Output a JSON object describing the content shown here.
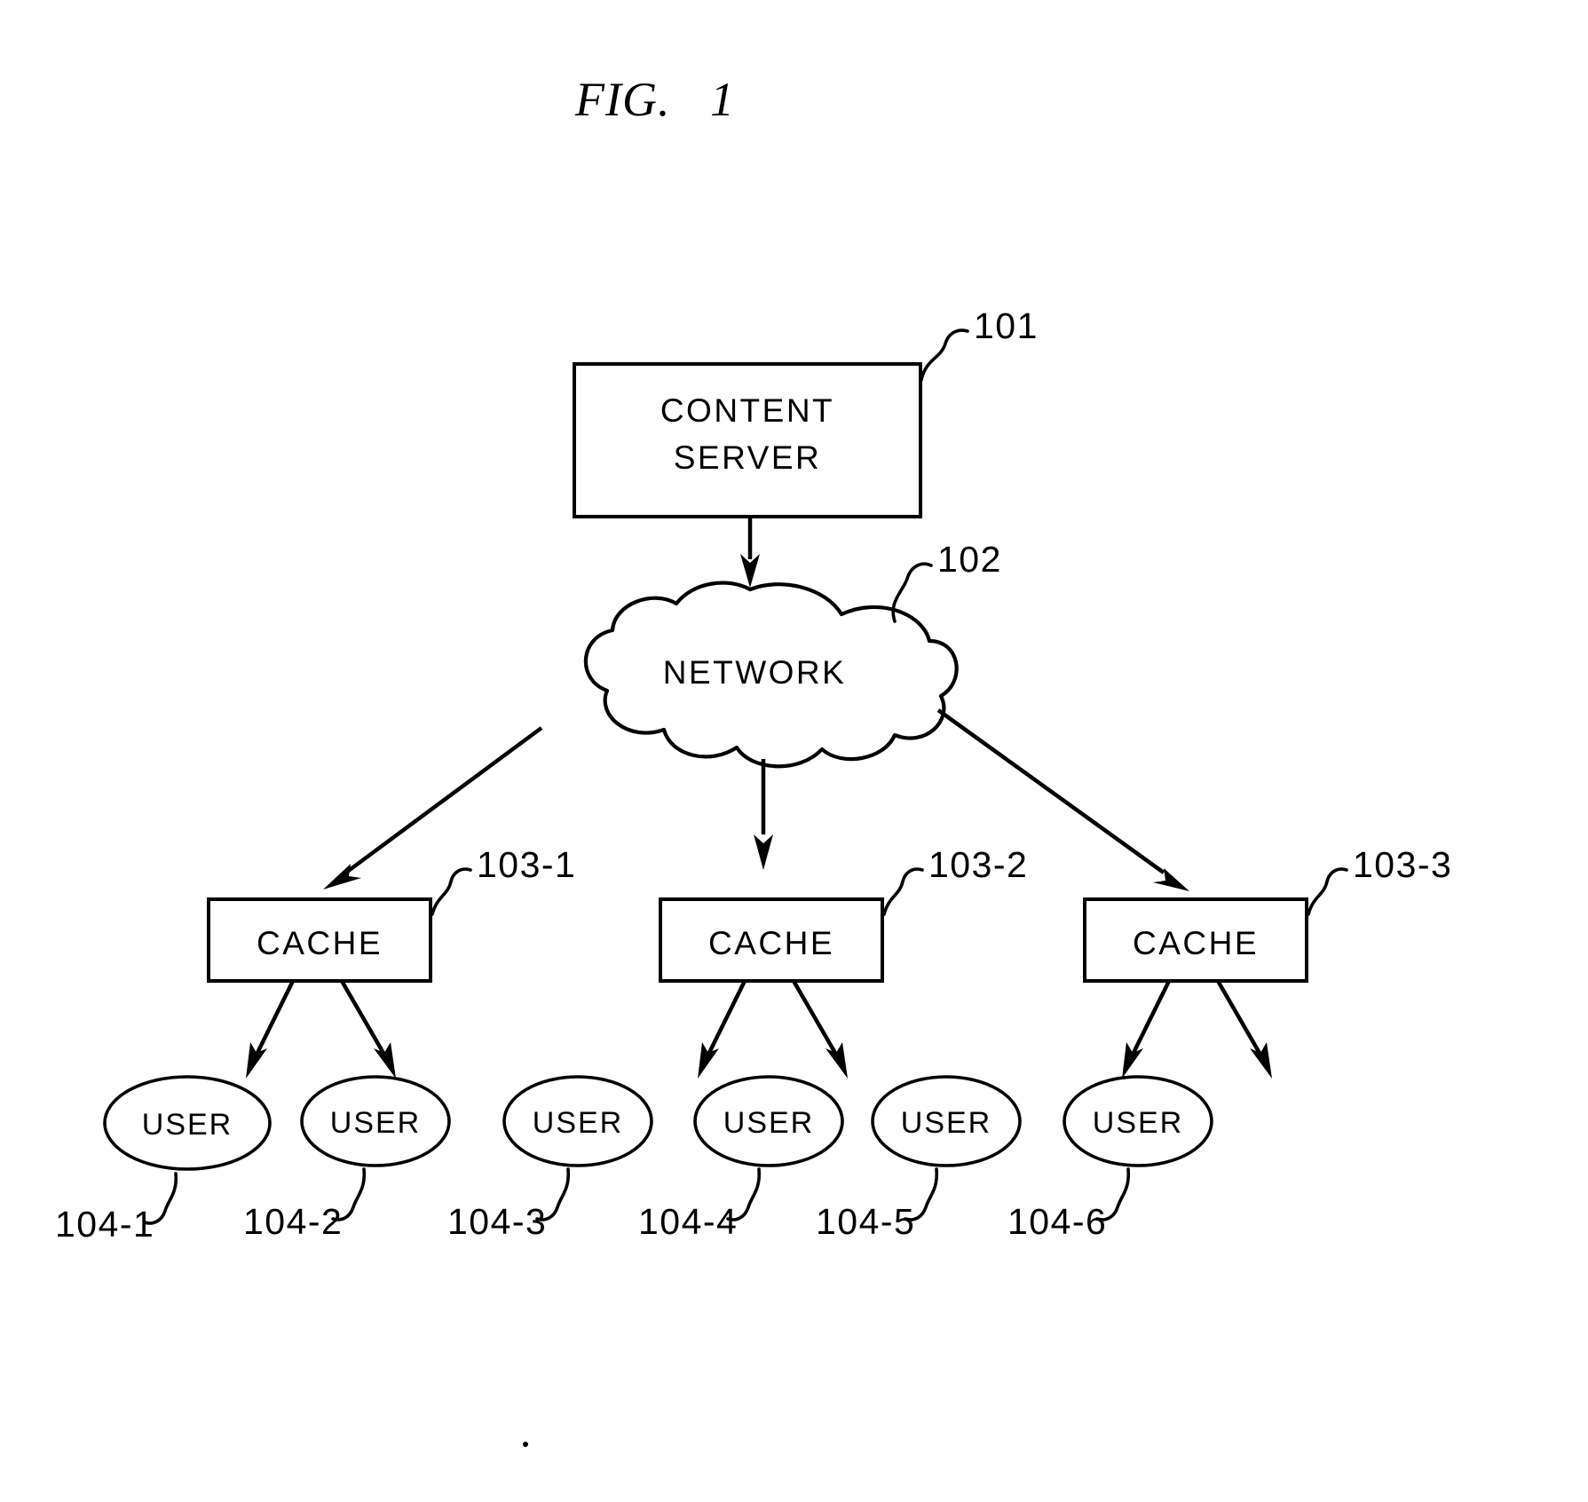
{
  "figure": {
    "title": "FIG.",
    "number": "1"
  },
  "nodes": {
    "content_server": {
      "line1": "CONTENT",
      "line2": "SERVER",
      "ref": "101"
    },
    "network": {
      "label": "NETWORK",
      "ref": "102"
    },
    "caches": [
      {
        "label": "CACHE",
        "ref": "103-1"
      },
      {
        "label": "CACHE",
        "ref": "103-2"
      },
      {
        "label": "CACHE",
        "ref": "103-3"
      }
    ],
    "users": [
      {
        "label": "USER",
        "ref": "104-1"
      },
      {
        "label": "USER",
        "ref": "104-2"
      },
      {
        "label": "USER",
        "ref": "104-3"
      },
      {
        "label": "USER",
        "ref": "104-4"
      },
      {
        "label": "USER",
        "ref": "104-5"
      },
      {
        "label": "USER",
        "ref": "104-6"
      }
    ]
  },
  "colors": {
    "ink": "#000000",
    "paper": "#ffffff"
  }
}
